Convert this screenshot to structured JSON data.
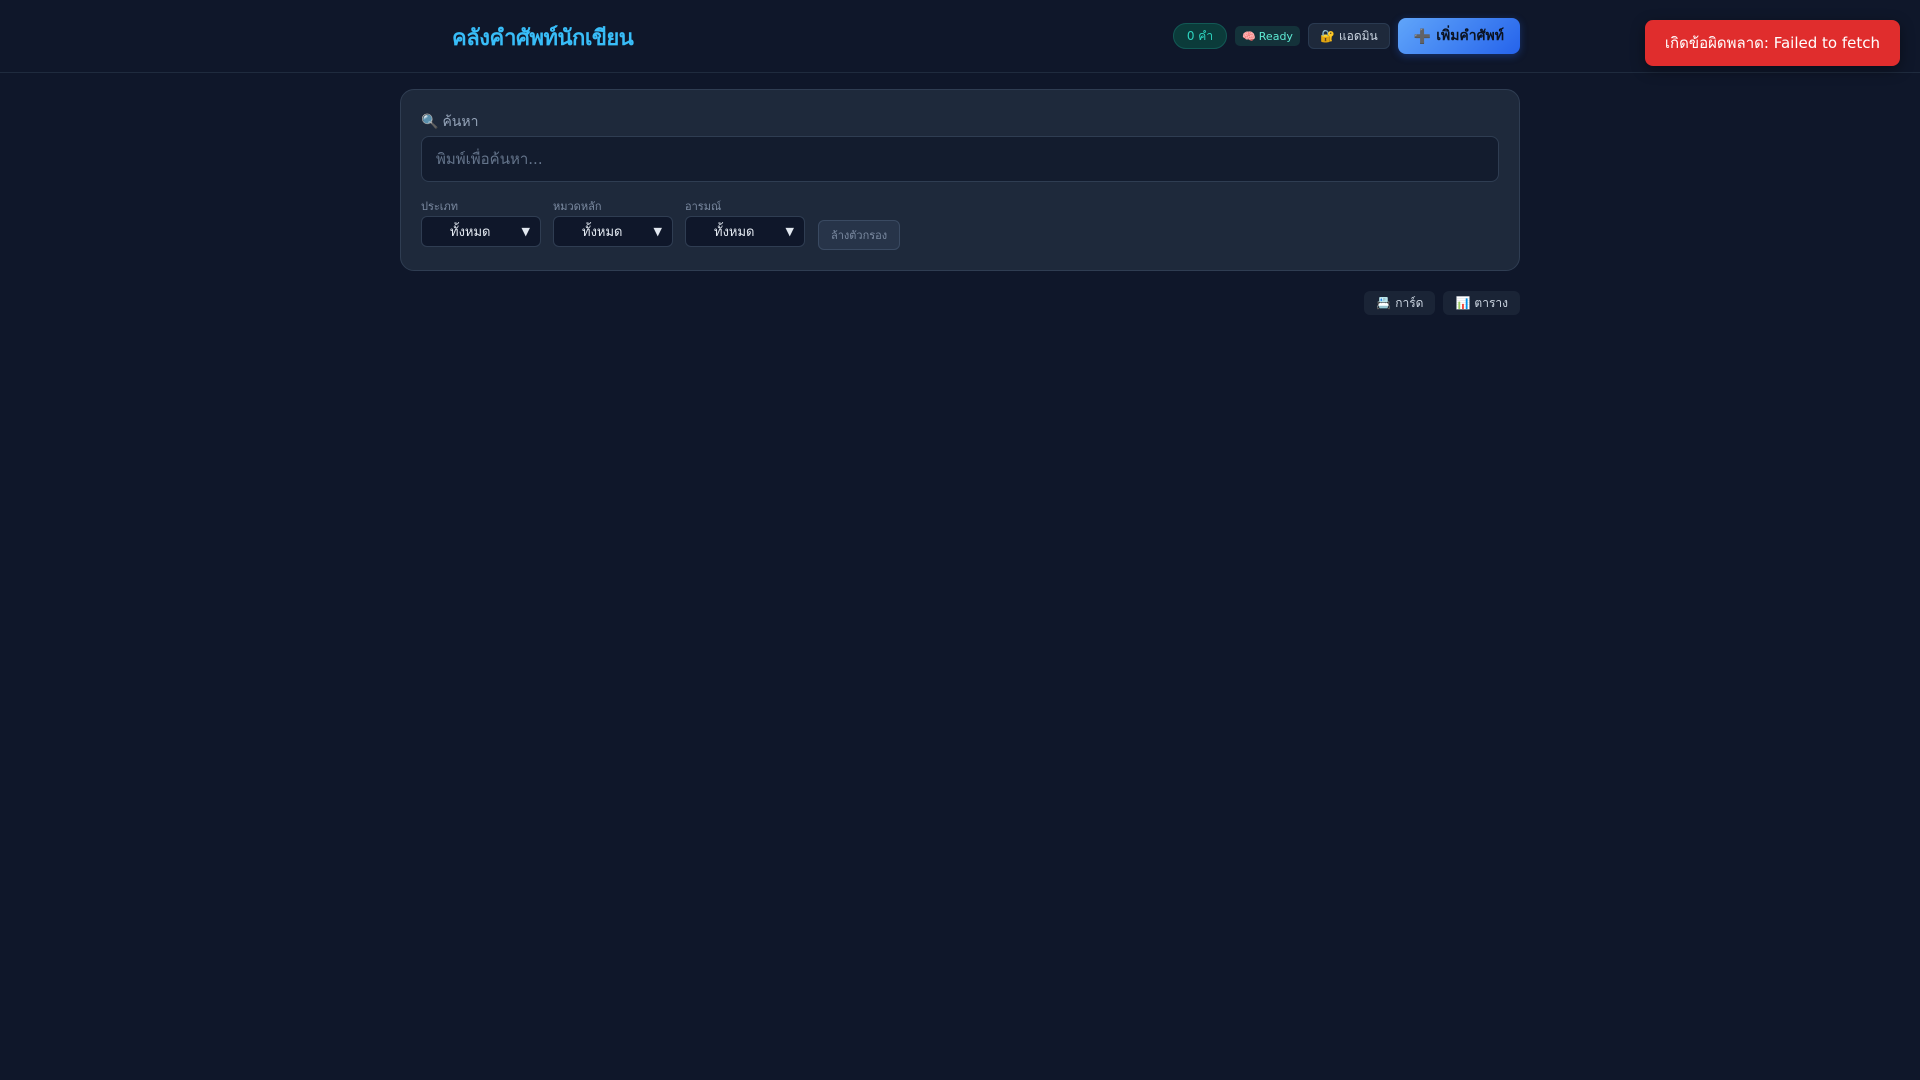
{
  "header": {
    "title": "คลังคำศัพท์นักเขียน",
    "count_badge": "0 คำ",
    "ai_status_icon": "🧠",
    "ai_status": "Ready",
    "admin_icon": "🔐",
    "admin_label": "แอดมิน",
    "add_icon": "➕",
    "add_label": "เพิ่มคำศัพท์"
  },
  "toast": {
    "message": "เกิดข้อผิดพลาด: Failed to fetch"
  },
  "search": {
    "icon": "🔍",
    "label": "ค้นหา",
    "value": "",
    "placeholder": "พิมพ์เพื่อค้นหา..."
  },
  "filters": {
    "type": {
      "label": "ประเภท",
      "value": "ทั้งหมด"
    },
    "category": {
      "label": "หมวดหลัก",
      "value": "ทั้งหมด"
    },
    "mood": {
      "label": "อารมณ์",
      "value": "ทั้งหมด"
    },
    "clear_label": "ล้างตัวกรอง"
  },
  "view": {
    "card_icon": "📇",
    "card_label": "การ์ด",
    "table_icon": "📊",
    "table_label": "ตาราง"
  },
  "colors": {
    "background": "#0f172a",
    "panel": "#1e293b",
    "accent": "#38bdf8",
    "primary": "#2563eb",
    "error": "#e02d2d",
    "success": "#2dd4bf"
  }
}
